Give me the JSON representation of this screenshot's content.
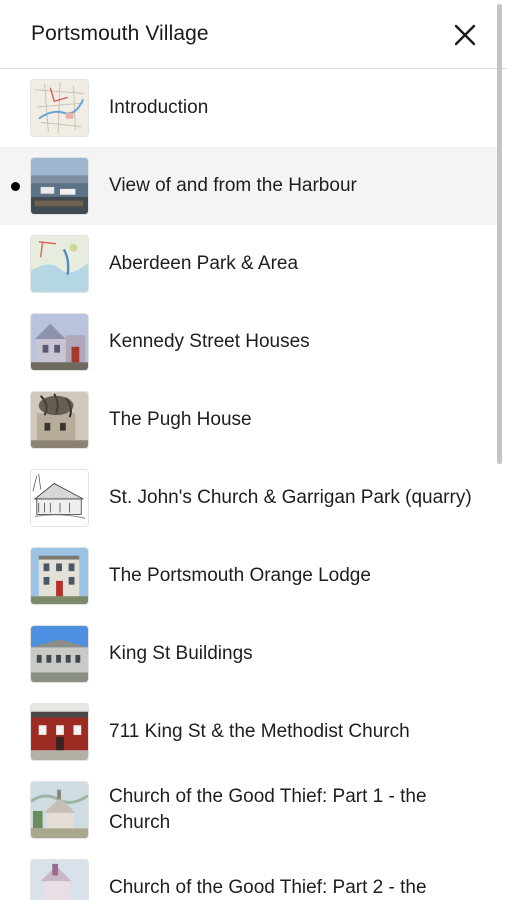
{
  "header": {
    "title": "Portsmouth Village",
    "close_icon": "close-icon"
  },
  "list": {
    "items": [
      {
        "label": "Introduction",
        "thumb": "map-thumbnail",
        "active": false
      },
      {
        "label": "View of and from the Harbour",
        "thumb": "harbour-thumbnail",
        "active": true
      },
      {
        "label": "Aberdeen Park & Area",
        "thumb": "park-map-thumbnail",
        "active": false
      },
      {
        "label": "Kennedy Street Houses",
        "thumb": "house-thumbnail",
        "active": false
      },
      {
        "label": "The Pugh House",
        "thumb": "pugh-house-thumbnail",
        "active": false
      },
      {
        "label": "St. John's Church & Garrigan Park (quarry)",
        "thumb": "church-sketch-thumbnail",
        "active": false
      },
      {
        "label": "The Portsmouth Orange Lodge",
        "thumb": "lodge-thumbnail",
        "active": false
      },
      {
        "label": "King St Buildings",
        "thumb": "buildings-thumbnail",
        "active": false
      },
      {
        "label": "711 King St & the Methodist Church",
        "thumb": "red-house-thumbnail",
        "active": false
      },
      {
        "label": "Church of the Good Thief: Part 1 - the Church",
        "thumb": "church-painting-thumbnail",
        "active": false
      },
      {
        "label": "Church of the Good Thief: Part 2 - the",
        "thumb": "church-painting-thumbnail-2",
        "active": false
      }
    ]
  },
  "colors": {
    "active_row": "#f4f4f4",
    "divider": "#dcdcdc",
    "text": "#1e1e1e"
  }
}
